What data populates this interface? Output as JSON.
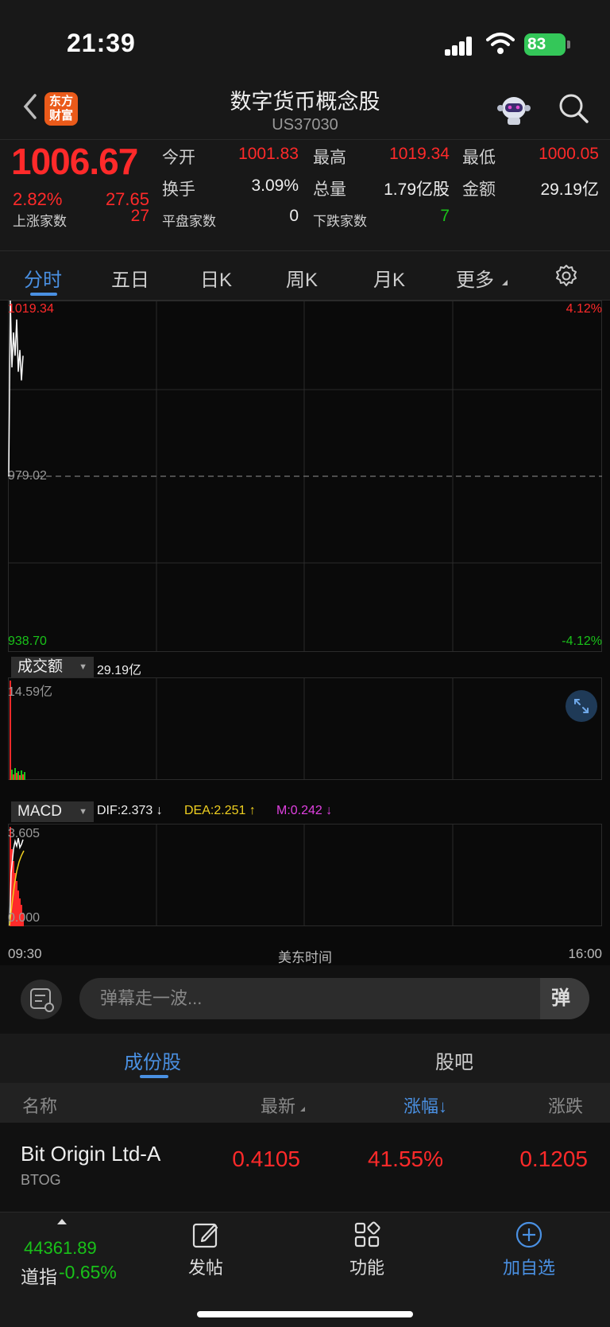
{
  "status": {
    "time": "21:39",
    "battery": "83"
  },
  "nav": {
    "logo": "东方财富",
    "title": "数字货币概念股",
    "code": "US37030"
  },
  "quote": {
    "price": "1006.67",
    "pct": "2.82%",
    "change": "27.65",
    "open_label": "今开",
    "open": "1001.83",
    "high_label": "最高",
    "high": "1019.34",
    "low_label": "最低",
    "low": "1000.05",
    "turnover_label": "换手",
    "turnover": "3.09%",
    "volume_label": "总量",
    "volume": "1.79亿股",
    "amount_label": "金额",
    "amount": "29.19亿",
    "up_label": "上涨家数",
    "up": "27",
    "flat_label": "平盘家数",
    "flat": "0",
    "down_label": "下跌家数",
    "down": "7"
  },
  "tabs": [
    "分时",
    "五日",
    "日K",
    "周K",
    "月K",
    "更多"
  ],
  "chart": {
    "price_high": "1019.34",
    "price_mid": "979.02",
    "price_low": "938.70",
    "pct_high": "4.12%",
    "pct_low": "-4.12%",
    "vol_dropdown": "成交额",
    "vol_total": "29.19亿",
    "vol_max": "14.59亿",
    "macd_dropdown": "MACD",
    "dif": "DIF:2.373 ↓",
    "dea": "DEA:2.251 ↑",
    "m": "M:0.242 ↓",
    "macd_max": "3.605",
    "macd_min": "0.000",
    "time_start": "09:30",
    "time_mid": "美东时间",
    "time_end": "16:00"
  },
  "chart_data": {
    "type": "line",
    "title": "",
    "ylim": [
      938.7,
      1019.34
    ],
    "prev_close": 979.02,
    "x": [
      "09:30",
      "16:00"
    ],
    "series": [
      {
        "values": [
          979.0,
          1019.34,
          1004.0,
          1012.0,
          1006.67,
          1015.0,
          1003.0,
          1008.0,
          1001.0,
          1006.67
        ]
      }
    ]
  },
  "danmu": {
    "placeholder": "弹幕走一波...",
    "toggle": "弹"
  },
  "sub_tabs": [
    "成份股",
    "股吧"
  ],
  "list": {
    "headers": [
      "名称",
      "最新",
      "涨幅↓",
      "涨跌"
    ],
    "rows": [
      {
        "name": "Bit Origin Ltd-A",
        "code": "BTOG",
        "last": "0.4105",
        "pct": "41.55%",
        "chg": "0.1205"
      }
    ]
  },
  "bottom": {
    "index_value": "44361.89",
    "index_name": "道指",
    "index_change": "-0.65%",
    "post": "发帖",
    "func": "功能",
    "add": "加自选"
  },
  "colors": {
    "up": "#ff2a2a",
    "down": "#19c219",
    "accent": "#4a90e2",
    "dea": "#f0d020",
    "macd_m": "#e040e0"
  }
}
